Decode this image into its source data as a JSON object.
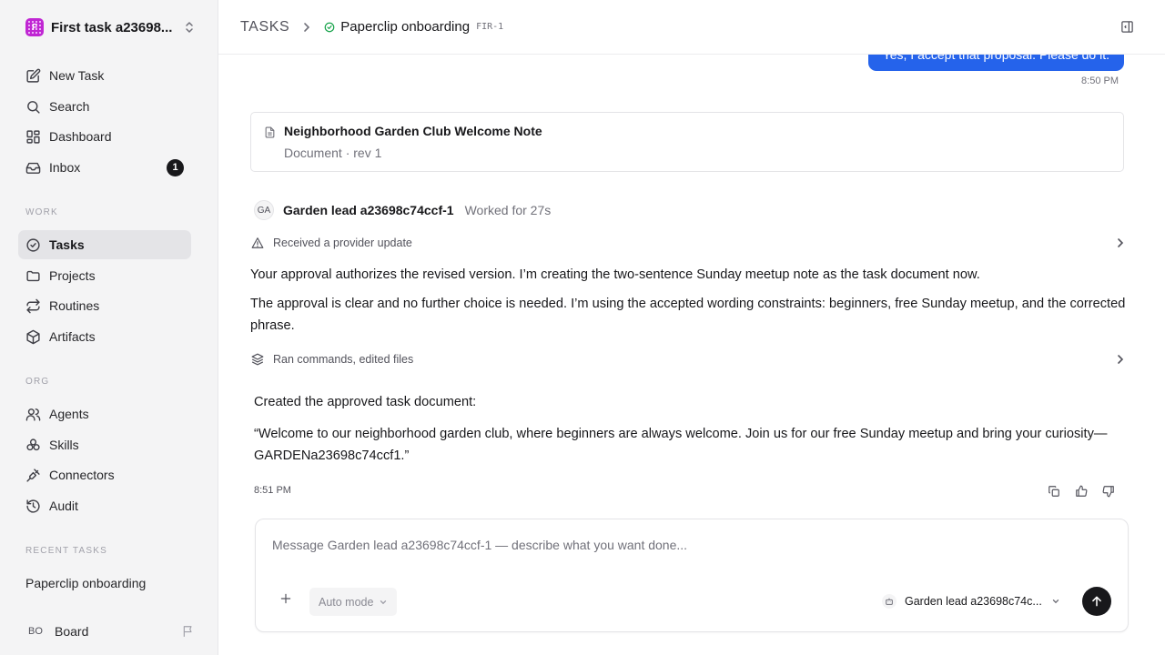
{
  "workspace": {
    "name": "First task a23698...",
    "logo_letter": "F"
  },
  "nav": {
    "new_task": "New Task",
    "search": "Search",
    "dashboard": "Dashboard",
    "inbox": "Inbox",
    "inbox_count": "1"
  },
  "work": {
    "label": "WORK",
    "tasks": "Tasks",
    "projects": "Projects",
    "routines": "Routines",
    "artifacts": "Artifacts"
  },
  "org": {
    "label": "ORG",
    "agents": "Agents",
    "skills": "Skills",
    "connectors": "Connectors",
    "audit": "Audit"
  },
  "recent": {
    "label": "RECENT TASKS",
    "items": [
      "Paperclip onboarding"
    ]
  },
  "board": {
    "initials": "BO",
    "label": "Board"
  },
  "header": {
    "root": "TASKS",
    "title": "Paperclip onboarding",
    "task_id": "FIR-1"
  },
  "thread": {
    "user_message": "Yes, I accept that proposal. Please do it.",
    "user_time": "8:50 PM",
    "document": {
      "title": "Neighborhood Garden Club Welcome Note",
      "meta": "Document · rev 1"
    },
    "agent": {
      "initials": "GA",
      "name": "Garden lead a23698c74ccf-1",
      "worked": "Worked for 27s"
    },
    "event_provider": "Received a provider update",
    "para1": "Your approval authorizes the revised version. I’m creating the two-sentence Sunday meetup note as the task document now.",
    "para2": "The approval is clear and no further choice is needed. I’m using the accepted wording constraints: beginners, free Sunday meetup, and the corrected phrase.",
    "event_commands": "Ran commands, edited files",
    "result_intro": "Created the approved task document:",
    "result_quote": "“Welcome to our neighborhood garden club, where beginners are always welcome. Join us for our free Sunday meetup and bring your curiosity—GARDENa23698c74ccf1.”",
    "agent_time": "8:51 PM"
  },
  "composer": {
    "placeholder": "Message Garden lead a23698c74ccf-1 — describe what you want done...",
    "mode": "Auto mode",
    "agent_select": "Garden lead a23698c74c..."
  },
  "colors": {
    "accent": "#2563eb",
    "status_done": "#16a34a",
    "sidebar_bg": "#f4f4f5"
  }
}
